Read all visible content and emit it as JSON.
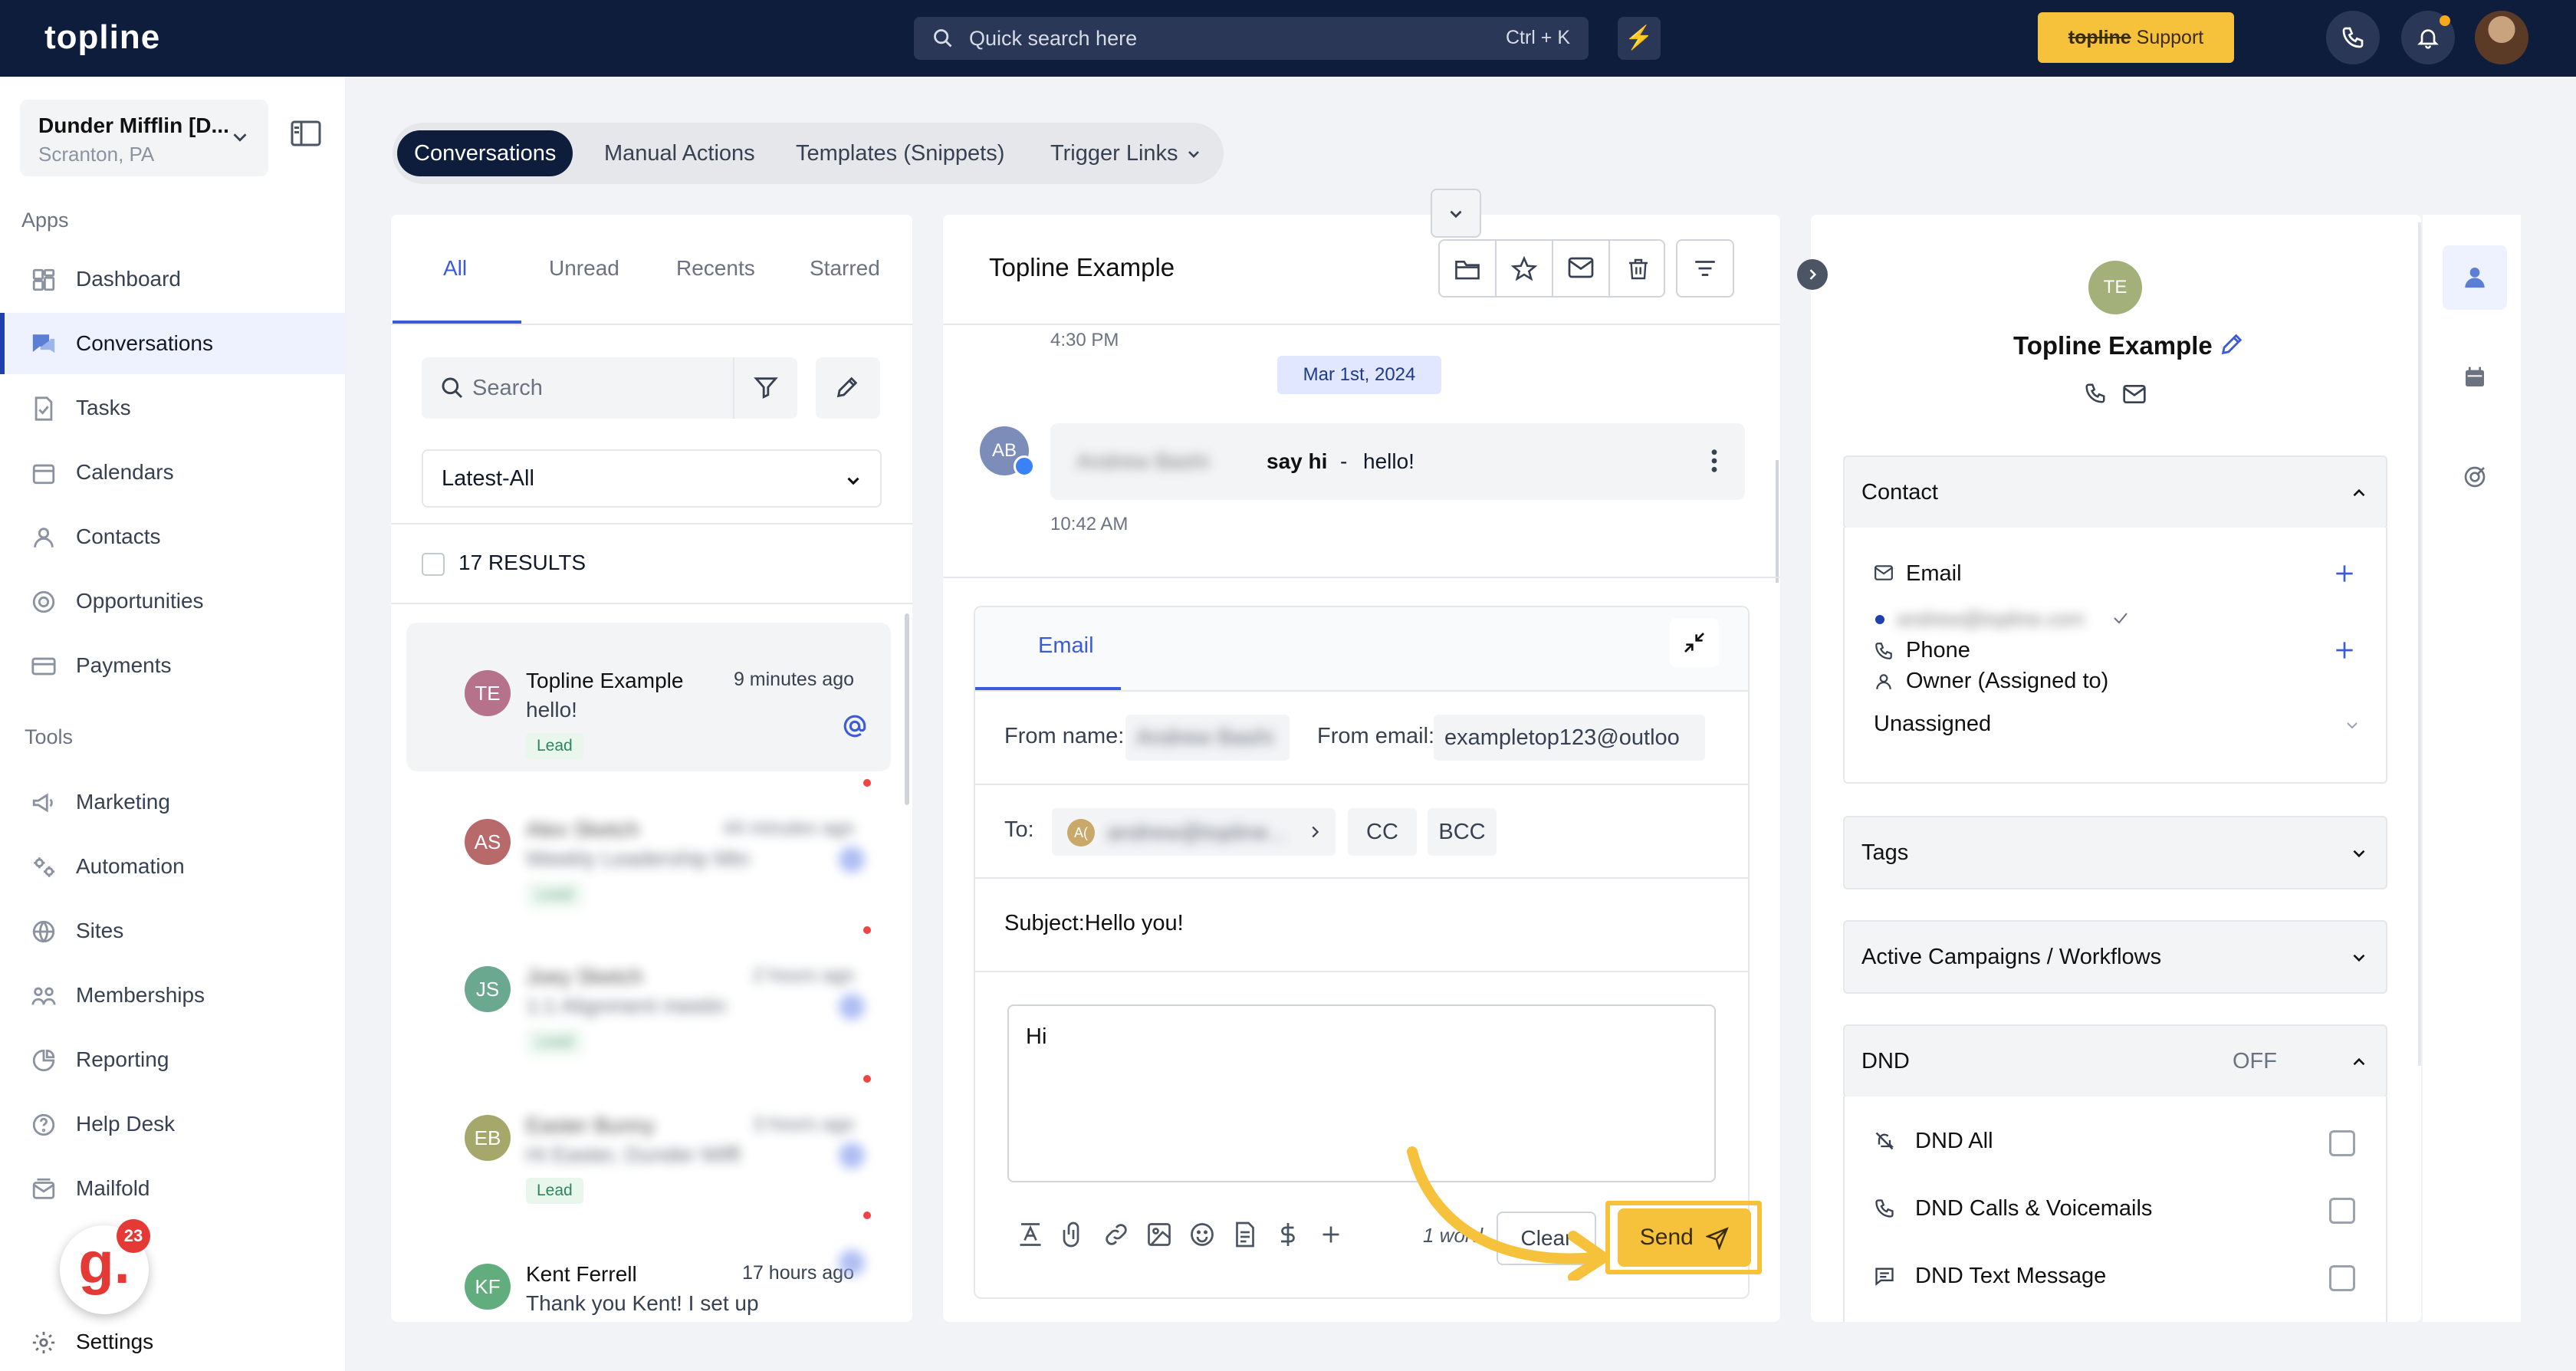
{
  "topbar": {
    "logo": "topline",
    "search_placeholder": "Quick search here",
    "search_shortcut": "Ctrl + K",
    "support_brand": "topline",
    "support_label": "Support"
  },
  "sidebar": {
    "account_name": "Dunder Mifflin [D...",
    "account_location": "Scranton, PA",
    "apps_heading": "Apps",
    "tools_heading": "Tools",
    "apps": [
      {
        "label": "Dashboard",
        "icon": "dashboard-icon"
      },
      {
        "label": "Conversations",
        "icon": "chat-icon",
        "active": true
      },
      {
        "label": "Tasks",
        "icon": "task-icon"
      },
      {
        "label": "Calendars",
        "icon": "calendar-icon"
      },
      {
        "label": "Contacts",
        "icon": "person-icon"
      },
      {
        "label": "Opportunities",
        "icon": "target-icon"
      },
      {
        "label": "Payments",
        "icon": "card-icon"
      }
    ],
    "tools": [
      {
        "label": "Marketing",
        "icon": "megaphone-icon"
      },
      {
        "label": "Automation",
        "icon": "gears-icon"
      },
      {
        "label": "Sites",
        "icon": "globe-icon"
      },
      {
        "label": "Memberships",
        "icon": "group-icon"
      },
      {
        "label": "Reporting",
        "icon": "pie-chart-icon"
      },
      {
        "label": "Help Desk",
        "icon": "help-icon"
      },
      {
        "label": "Mailfold",
        "icon": "mail-stack-icon"
      }
    ],
    "settings_label": "Settings",
    "badge_letter": "g.",
    "badge_count": "23"
  },
  "top_tabs": [
    "Conversations",
    "Manual Actions",
    "Templates (Snippets)",
    "Trigger Links"
  ],
  "list": {
    "filter_tabs": [
      "All",
      "Unread",
      "Recents",
      "Starred"
    ],
    "search_placeholder": "Search",
    "sort_value": "Latest-All",
    "results_label": "17 RESULTS",
    "items": [
      {
        "initials": "TE",
        "name": "Topline Example",
        "time": "9 minutes ago",
        "message": "hello!",
        "tag": "Lead",
        "color": "#b5728a",
        "blurred": false
      },
      {
        "initials": "AS",
        "name": "Alex Sketch",
        "time": "44 minutes ago",
        "message": "Weekly Leadership Mtn",
        "tag": "Lead",
        "color": "#b86a6a",
        "blurred": true
      },
      {
        "initials": "JS",
        "name": "Joey Sketch",
        "time": "2 hours ago",
        "message": "1:1 Alignment meetin",
        "tag": "Lead",
        "color": "#6aa88f",
        "blurred": true
      },
      {
        "initials": "EB",
        "name": "Easter Bunny",
        "time": "3 hours ago",
        "message": "Hi Easter, Dunder Miffl",
        "tag": "Lead",
        "color": "#a5a86a",
        "blurred": true
      },
      {
        "initials": "KF",
        "name": "Kent Ferrell",
        "time": "17 hours ago",
        "message": "Thank you Kent! I set up",
        "tag": "",
        "color": "#62ad7d",
        "blurred": false
      }
    ]
  },
  "chat": {
    "title": "Topline Example",
    "prev_time": "4:30 PM",
    "date_badge": "Mar 1st, 2024",
    "message_avatar": "AB",
    "message_sender": "Andrew Bashi",
    "message_subject": "say hi",
    "message_sep": "-",
    "message_body": "hello!",
    "message_time": "10:42 AM"
  },
  "composer": {
    "tab": "Email",
    "from_name_label": "From name:",
    "from_name_value": "Andrew Bashi",
    "from_email_label": "From email:",
    "from_email_value": "exampletop123@outloo",
    "to_label": "To:",
    "to_chip_initials": "A(",
    "to_chip_value": "andrew@topline...",
    "cc_label": "CC",
    "bcc_label": "BCC",
    "subject_text": "Subject:Hello you!",
    "body_text": "Hi",
    "word_count": "1 word",
    "clear_label": "Clear",
    "send_label": "Send"
  },
  "contact": {
    "initials": "TE",
    "name": "Topline Example",
    "contact_section": "Contact",
    "email_label": "Email",
    "email_value": "andrew@topline.com",
    "phone_label": "Phone",
    "owner_label": "Owner (Assigned to)",
    "owner_value": "Unassigned",
    "tags_section": "Tags",
    "campaigns_section": "Active Campaigns / Workflows",
    "dnd_section": "DND",
    "dnd_state": "OFF",
    "dnd_items": [
      "DND All",
      "DND Calls & Voicemails",
      "DND Text Message"
    ]
  },
  "colors": {
    "navy": "#0f1d3d",
    "accent": "#f6c23b",
    "blue": "#3b5bdb"
  }
}
